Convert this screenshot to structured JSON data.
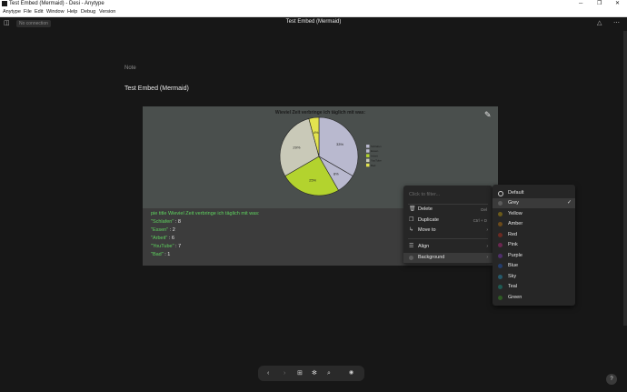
{
  "window": {
    "title": "Test Embed (Mermaid) - Desi - Anytype"
  },
  "menubar": [
    "Anytype",
    "File",
    "Edit",
    "Window",
    "Help",
    "Debug",
    "Version"
  ],
  "header": {
    "connection": "No connection",
    "doc_title": "Test Embed (Mermaid)"
  },
  "page": {
    "breadcrumb": "Note",
    "title": "Test Embed (Mermaid)"
  },
  "chart_data": {
    "type": "pie",
    "title": "Wieviel Zeit verbringe ich täglich mit was:",
    "categories": [
      "Schlafen",
      "Essen",
      "Arbeit",
      "YouTube",
      "Bad"
    ],
    "values": [
      8,
      2,
      6,
      7,
      1
    ],
    "slice_labels": [
      "33%",
      "8%",
      "25%",
      "29%",
      "4%"
    ],
    "colors": [
      "#b9b9cf",
      "#b9b9cf",
      "#b3d32e",
      "#c9c9b8",
      "#e3e34f"
    ],
    "legend": "right"
  },
  "code": {
    "line1": "pie title Wieviel Zeit verbringe ich täglich mit was:",
    "rows": [
      {
        "k": "\"Schlafen\"",
        "v": " : 8"
      },
      {
        "k": "\"Essen\"",
        "v": " : 2"
      },
      {
        "k": "\"Arbeit\"",
        "v": " : 6"
      },
      {
        "k": "\"YouTube\"",
        "v": " : 7"
      },
      {
        "k": "\"Bad\"",
        "v": " : 1"
      }
    ]
  },
  "context_menu": {
    "filter_placeholder": "Click to filter...",
    "items": [
      {
        "label": "Delete",
        "shortcut": "Del",
        "icon": "trash-icon"
      },
      {
        "label": "Duplicate",
        "shortcut": "Ctrl + D",
        "icon": "duplicate-icon"
      },
      {
        "label": "Move to",
        "shortcut": "",
        "icon": "move-icon"
      },
      {
        "label": "Align",
        "shortcut": "",
        "icon": "align-icon"
      },
      {
        "label": "Background",
        "shortcut": "",
        "icon": "background-icon"
      }
    ]
  },
  "color_menu": {
    "items": [
      {
        "label": "Default",
        "color": "#262626"
      },
      {
        "label": "Grey",
        "color": "#5c5c5c"
      },
      {
        "label": "Yellow",
        "color": "#6b5a1a"
      },
      {
        "label": "Amber",
        "color": "#6b4a1a"
      },
      {
        "label": "Red",
        "color": "#6b2a22"
      },
      {
        "label": "Pink",
        "color": "#6a2650"
      },
      {
        "label": "Purple",
        "color": "#4f2f6b"
      },
      {
        "label": "Blue",
        "color": "#243d6b"
      },
      {
        "label": "Sky",
        "color": "#265a6b"
      },
      {
        "label": "Teal",
        "color": "#1f5a52"
      },
      {
        "label": "Green",
        "color": "#2f5a24"
      }
    ],
    "selected": "Grey"
  },
  "bottombar": [
    "back-icon",
    "forward-icon",
    "add-icon",
    "graph-icon",
    "search-icon"
  ],
  "help": "?"
}
